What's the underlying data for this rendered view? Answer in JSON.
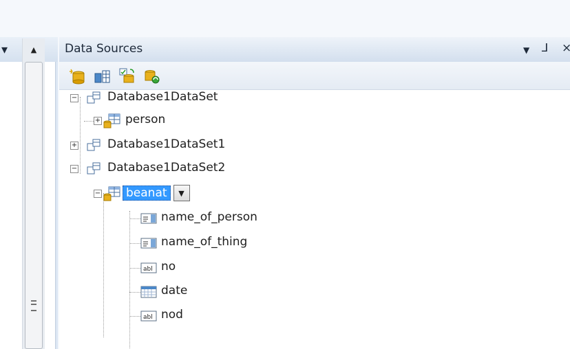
{
  "left_panel": {
    "pin_glyph": "▾",
    "close_glyph": "✕",
    "scroll_up_glyph": "▲"
  },
  "data_sources": {
    "title": "Data Sources",
    "dropdown_glyph": "▼",
    "pin_glyph": "ᒧ",
    "close_glyph": "×"
  },
  "toolbar": {
    "buttons": [
      "add-new-data-source-icon",
      "edit-dataset-designer-icon",
      "configure-dataset-wizard-icon",
      "refresh-icon"
    ]
  },
  "tree": {
    "ds1": "Database1DataSet",
    "person": "person",
    "ds2": "Database1DataSet1",
    "ds3": "Database1DataSet2",
    "beanat": "beanat",
    "fields": [
      {
        "name": "name_of_person",
        "icon": "combobox-field-icon"
      },
      {
        "name": "name_of_thing",
        "icon": "combobox-field-icon"
      },
      {
        "name": "no",
        "icon": "textbox-field-icon"
      },
      {
        "name": "date",
        "icon": "datetime-field-icon"
      },
      {
        "name": "nod",
        "icon": "textbox-field-icon"
      }
    ]
  },
  "colors": {
    "selection": "#3399ff",
    "panel_header": "#d3dfee"
  }
}
